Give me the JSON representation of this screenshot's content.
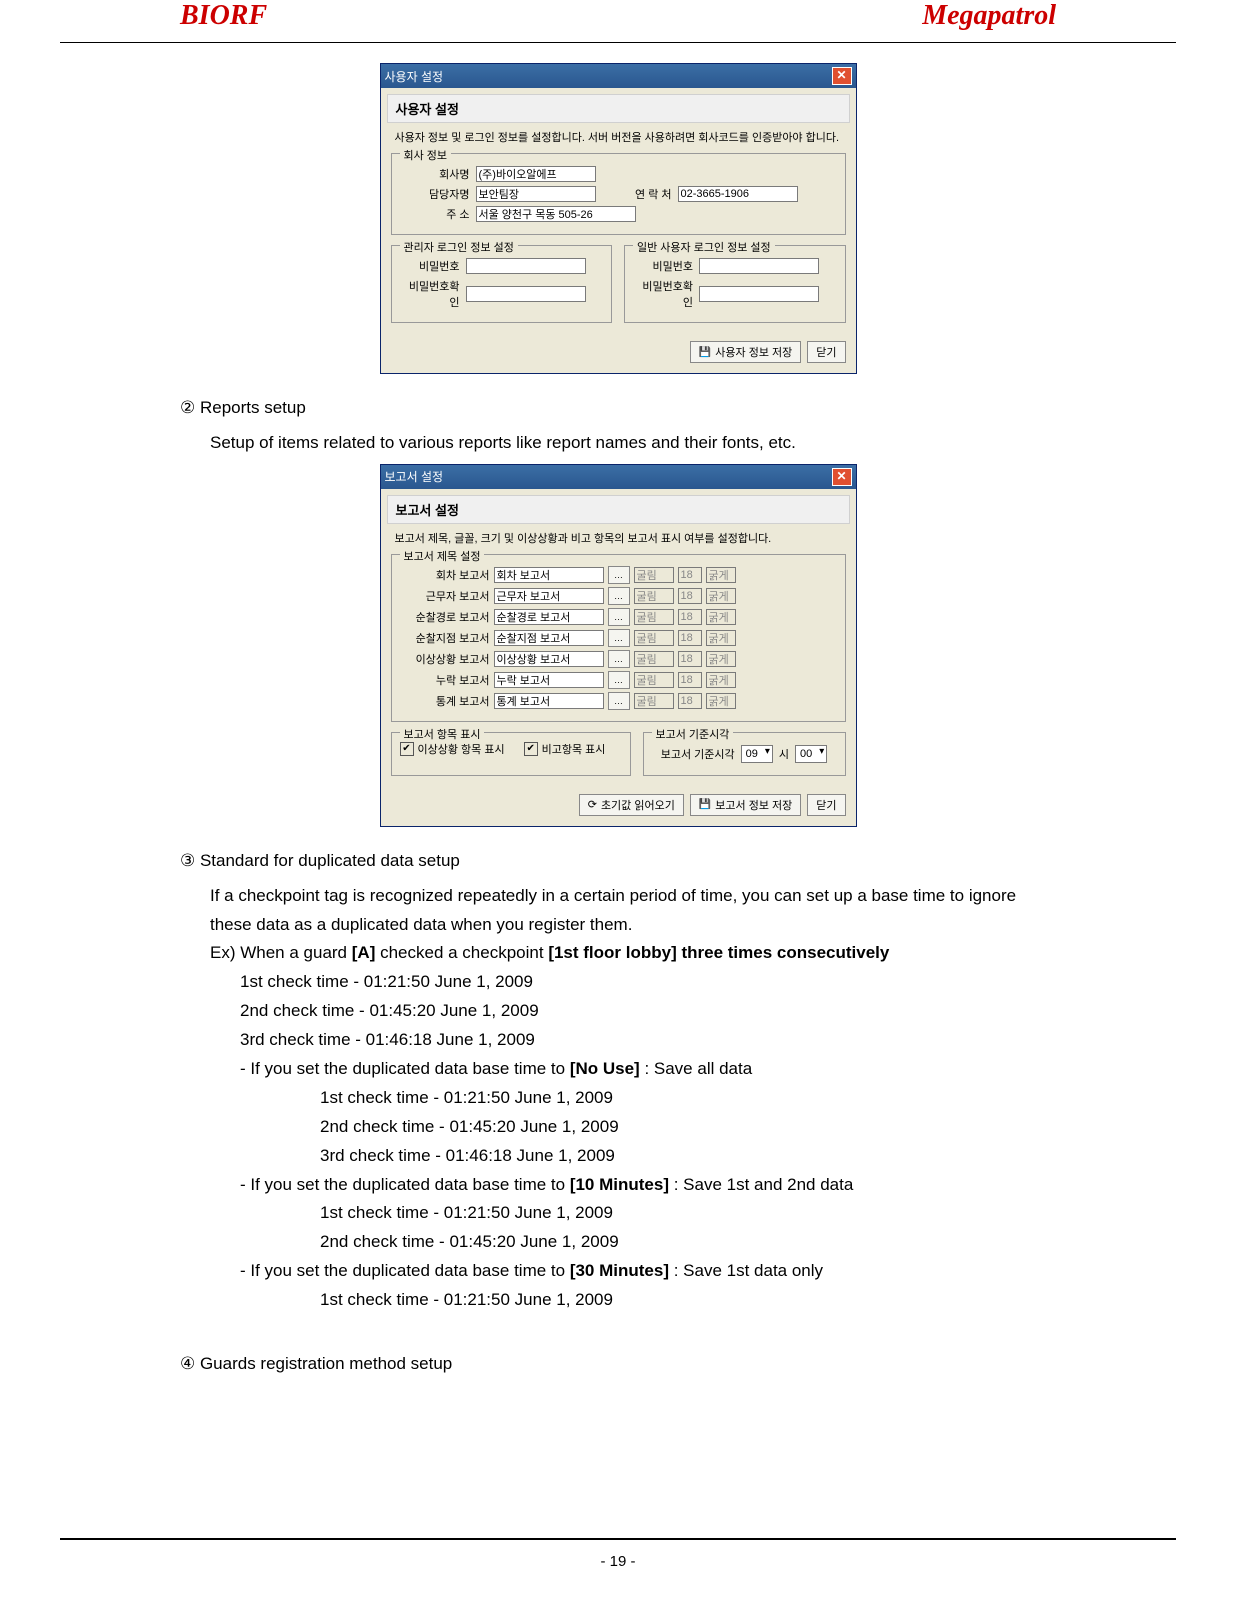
{
  "header": {
    "left": "BIORF",
    "right": "Megapatrol"
  },
  "page_number": "- 19 -",
  "dialog1": {
    "title": "사용자 설정",
    "subtitle": "사용자 설정",
    "desc": "사용자 정보 및 로그인 정보를 설정합니다. 서버 버전을 사용하려면 회사코드를 인증받아야 합니다.",
    "group_company": "회사 정보",
    "company_label": "회사명",
    "company_value": "(주)바이오알에프",
    "manager_label": "담당자명",
    "manager_value": "보안팀장",
    "phone_label": "연 락 처",
    "phone_value": "02-3665-1906",
    "addr_label": "주   소",
    "addr_value": "서울 양천구 목동 505-26",
    "group_admin": "관리자 로그인 정보 설정",
    "group_user": "일반 사용자 로그인 정보 설정",
    "pw_label": "비밀번호",
    "pw2_label": "비밀번호확인",
    "save_btn": "사용자 정보 저장",
    "close_btn": "닫기"
  },
  "sec2": {
    "head": "② Reports setup",
    "desc": "Setup of items related to various reports like report names and their fonts, etc."
  },
  "dialog2": {
    "title": "보고서 설정",
    "subtitle": "보고서 설정",
    "desc": "보고서 제목, 글꼴, 크기 및 이상상황과 비고 항목의 보고서 표시 여부를 설정합니다.",
    "group_title": "보고서 제목 설정",
    "rows": [
      {
        "l": "회차 보고서",
        "v": "회차 보고서",
        "f": "굴림",
        "s": "18",
        "w": "굵게"
      },
      {
        "l": "근무자 보고서",
        "v": "근무자 보고서",
        "f": "굴림",
        "s": "18",
        "w": "굵게"
      },
      {
        "l": "순찰경로 보고서",
        "v": "순찰경로 보고서",
        "f": "굴림",
        "s": "18",
        "w": "굵게"
      },
      {
        "l": "순찰지점 보고서",
        "v": "순찰지점 보고서",
        "f": "굴림",
        "s": "18",
        "w": "굵게"
      },
      {
        "l": "이상상황 보고서",
        "v": "이상상황 보고서",
        "f": "굴림",
        "s": "18",
        "w": "굵게"
      },
      {
        "l": "누락 보고서",
        "v": "누락 보고서",
        "f": "굴림",
        "s": "18",
        "w": "굵게"
      },
      {
        "l": "통계 보고서",
        "v": "통계 보고서",
        "f": "굴림",
        "s": "18",
        "w": "굵게"
      }
    ],
    "group_disp": "보고서 항목 표시",
    "chk1": "이상상황 항목 표시",
    "chk2": "비고항목 표시",
    "group_time": "보고서 기준시각",
    "time_label": "보고서 기준시각",
    "hour": "09",
    "h_unit": "시",
    "min": "00",
    "m_unit": "",
    "reset_btn": "초기값 읽어오기",
    "save_btn": "보고서 정보 저장",
    "close_btn": "닫기"
  },
  "sec3": {
    "head": "③ Standard for duplicated data setup",
    "p1": "If a checkpoint tag is recognized repeatedly in a certain period of time, you can set up a base time to ignore these data as a duplicated data when you register them.",
    "ex_pre": "Ex) When a guard ",
    "ex_bold1": "[A]",
    "ex_mid1": " checked  a checkpoint ",
    "ex_bold2": "[1st floor lobby] three times consecutively",
    "t1": "1st check time -  01:21:50 June 1, 2009",
    "t2": "2nd check time - 01:45:20 June 1, 2009",
    "t3": "3rd check time - 01:46:18 June 1, 2009",
    "c1_pre": "- If you set the duplicated data base time to ",
    "c1_b": "[No Use]",
    "c1_post": " : Save all data",
    "c1_t1": "1st check time -  01:21:50 June 1, 2009",
    "c1_t2": "2nd check time - 01:45:20 June 1, 2009",
    "c1_t3": "3rd check time - 01:46:18 June 1, 2009",
    "c2_pre": "- If you set the duplicated data base time to ",
    "c2_b": "[10 Minutes]",
    "c2_post": " : Save 1st and 2nd data",
    "c2_t1": "1st check time -  01:21:50 June 1, 2009",
    "c2_t2": "2nd check time - 01:45:20 June 1, 2009",
    "c3_pre": "- If you set the duplicated data base time to ",
    "c3_b": "[30 Minutes]",
    "c3_post": " : Save 1st data only",
    "c3_t1": "1st check time -  01:21:50 June 1, 2009"
  },
  "sec4": {
    "head": "④ Guards registration method setup"
  }
}
